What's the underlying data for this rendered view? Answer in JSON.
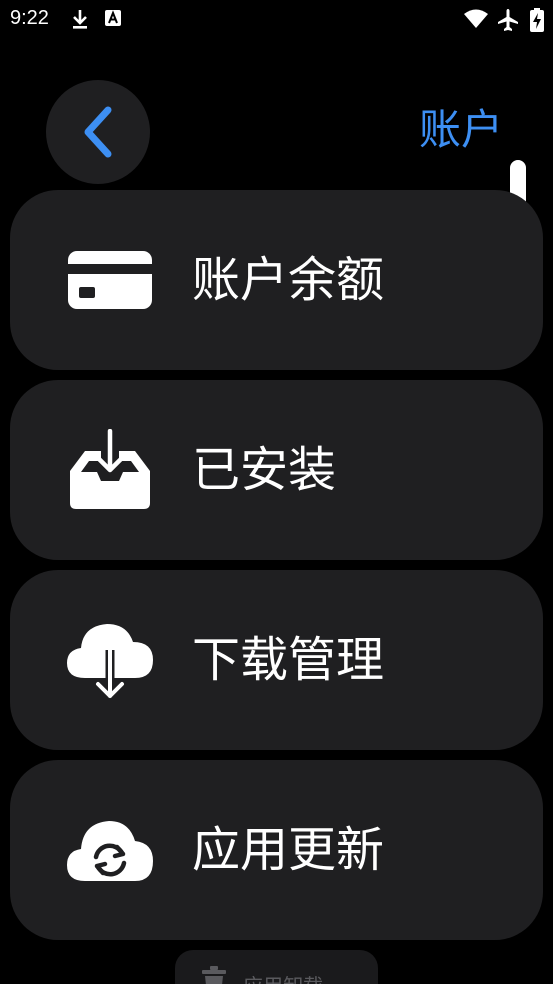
{
  "status_bar": {
    "time": "9:22",
    "left_icons": [
      "download-icon",
      "a-badge-icon"
    ],
    "right_icons": [
      "wifi-icon",
      "airplane-icon",
      "battery-charging-icon"
    ]
  },
  "header": {
    "back_icon": "chevron-left-icon",
    "title": "账户",
    "accent_color": "#3d8ff3"
  },
  "menu": {
    "items": [
      {
        "label": "账户余额",
        "icon": "card-icon"
      },
      {
        "label": "已安装",
        "icon": "inbox-download-icon"
      },
      {
        "label": "下载管理",
        "icon": "cloud-download-icon"
      },
      {
        "label": "应用更新",
        "icon": "cloud-sync-icon"
      }
    ]
  },
  "bottom": {
    "uninstall_label": "应用卸载",
    "uninstall_icon": "trash-icon"
  },
  "colors": {
    "background": "#000000",
    "card": "#1f1f21",
    "text": "#ffffff"
  }
}
